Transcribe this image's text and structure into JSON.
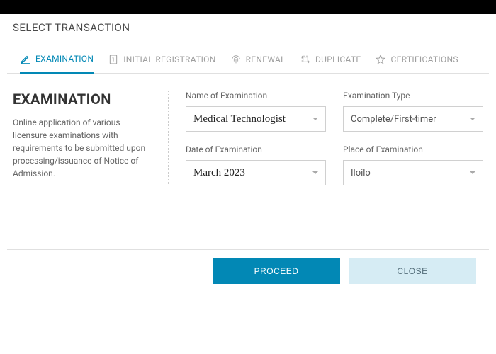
{
  "title": "SELECT TRANSACTION",
  "tabs": {
    "examination": "EXAMINATION",
    "initial": "INITIAL REGISTRATION",
    "renewal": "RENEWAL",
    "duplicate": "DUPLICATE",
    "cert": "CERTIFICATIONS"
  },
  "sidebar": {
    "heading": "EXAMINATION",
    "desc": "Online application of various licensure examinations with requirements to be submitted upon processing/issuance of Notice of Admission."
  },
  "fields": {
    "name_label": "Name of Examination",
    "name_value": "Medical Technologist",
    "type_label": "Examination Type",
    "type_value": "Complete/First-timer",
    "date_label": "Date of Examination",
    "date_value": "March 2023",
    "place_label": "Place of Examination",
    "place_value": "Iloilo"
  },
  "buttons": {
    "proceed": "PROCEED",
    "close": "CLOSE"
  }
}
